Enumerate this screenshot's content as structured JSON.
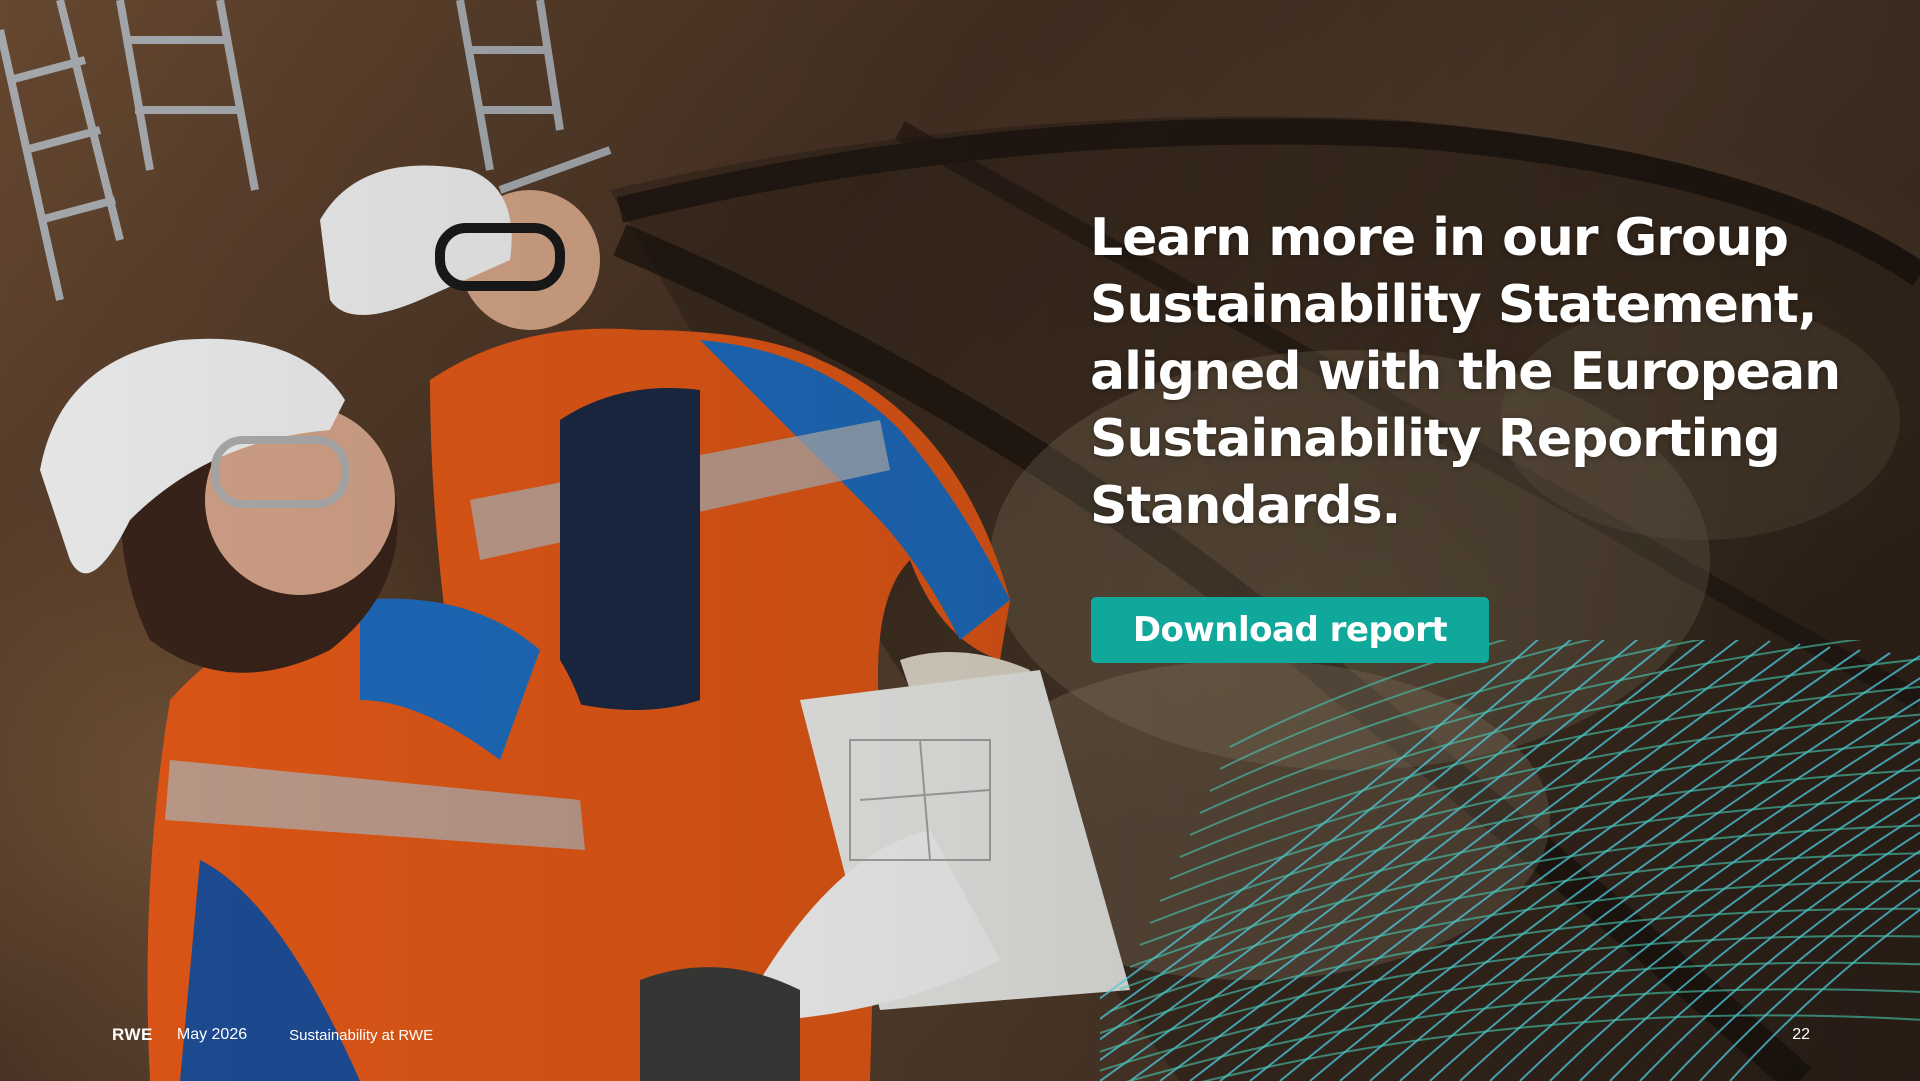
{
  "slide": {
    "headline": "Learn more in our Group Sustainability Statement, aligned with the European Sustainability Reporting Standards.",
    "cta_label": "Download report",
    "footer": {
      "logo": "RWE",
      "date": "May 2026",
      "section": "Sustainability at RWE"
    },
    "page_number": "22",
    "colors": {
      "accent": "#0fa89a",
      "text": "#ffffff",
      "wave_lines": "#4ec9e0"
    },
    "background_image": "two-engineers-in-hardhats-reviewing-plans"
  }
}
